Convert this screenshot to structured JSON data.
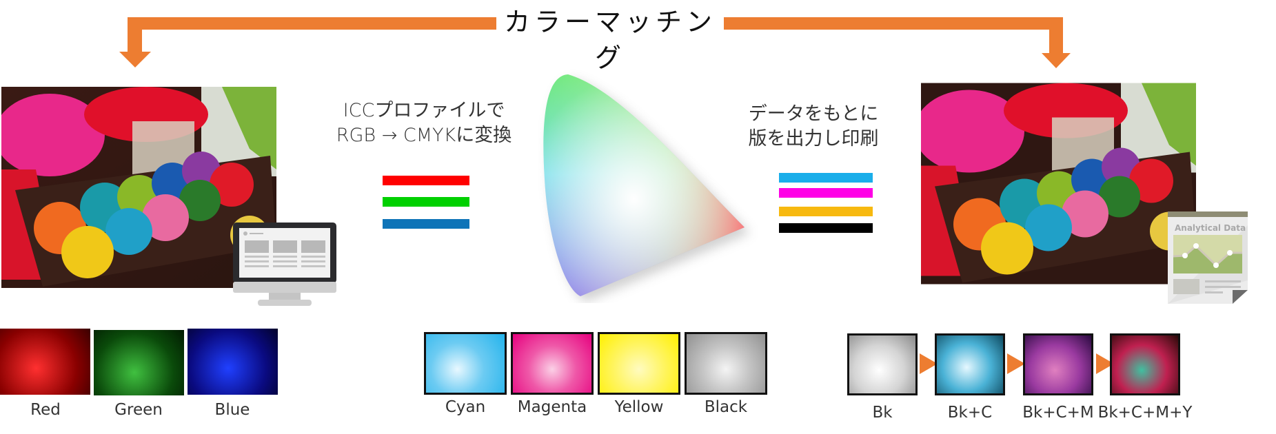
{
  "title": "カラーマッチング",
  "colors": {
    "arrow": "#ed7d31",
    "red": "#ff0000",
    "green": "#00d000",
    "blue": "#0e74b8",
    "cyan": "#1aaeea",
    "magenta": "#ff00e6",
    "yellow": "#f7b90f",
    "black": "#000000"
  },
  "left_caption": [
    "ICCプロファイルで",
    "RGB → CMYKに変換"
  ],
  "right_caption": [
    "データをもとに",
    "版を出力し印刷"
  ],
  "rgb_bars": [
    "red",
    "green",
    "blue"
  ],
  "cmyk_bars": [
    "cyan",
    "magenta",
    "yellow",
    "black"
  ],
  "source_image": {
    "label": "yarn-photo-rgb",
    "device": "monitor-icon"
  },
  "output_image": {
    "label": "yarn-photo-printed",
    "document": "Analytical Data"
  },
  "gamut": {
    "label": "color-gamut-diagram"
  },
  "rgb_channels": [
    {
      "label": "Red",
      "tint": "#ff0000"
    },
    {
      "label": "Green",
      "tint": "#00c000"
    },
    {
      "label": "Blue",
      "tint": "#0010ff"
    }
  ],
  "cmyk_separations": [
    {
      "label": "Cyan",
      "tint": "#23b3ec"
    },
    {
      "label": "Magenta",
      "tint": "#e6007e"
    },
    {
      "label": "Yellow",
      "tint": "#fff000"
    },
    {
      "label": "Black",
      "tint": "#9a9a9a"
    }
  ],
  "print_steps": [
    {
      "label": "Bk"
    },
    {
      "label": "Bk+C"
    },
    {
      "label": "Bk+C+M"
    },
    {
      "label": "Bk+C+M+Y"
    }
  ]
}
